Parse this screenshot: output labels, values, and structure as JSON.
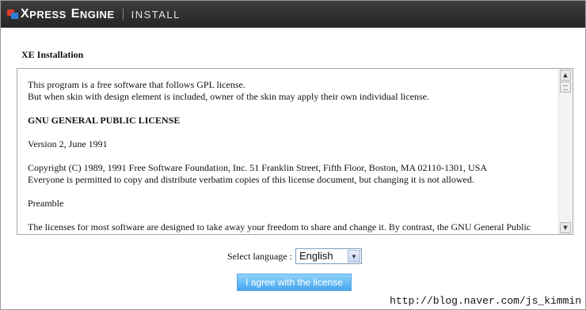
{
  "header": {
    "logo_x": "X",
    "logo_press": "PRESS",
    "logo_e": "E",
    "logo_ngine": "NGINE",
    "install": "INSTALL"
  },
  "section_title": "XE Installation",
  "license": {
    "paragraphs": [
      "This program is a free software that follows GPL license.",
      "But when skin with design element is included, owner of the skin may apply their own individual license.",
      "GNU GENERAL PUBLIC LICENSE",
      "Version 2, June 1991",
      "Copyright (C) 1989, 1991 Free Software Foundation, Inc. 51 Franklin Street, Fifth Floor, Boston, MA 02110-1301, USA",
      "Everyone is permitted to copy and distribute verbatim copies of this license document, but changing it is not allowed.",
      "Preamble",
      "The licenses for most software are designed to take away your freedom to share and change it. By contrast, the GNU General Public"
    ]
  },
  "language": {
    "label": "Select language :",
    "selected": "English"
  },
  "agree_button": "I agree with the license",
  "watermark": "http://blog.naver.com/js_kimmin",
  "colors": {
    "header_bg": "#2f2f2f",
    "logo_red": "#e03a2a",
    "logo_blue": "#2f7fd6",
    "button_blue": "#47a6ec"
  }
}
